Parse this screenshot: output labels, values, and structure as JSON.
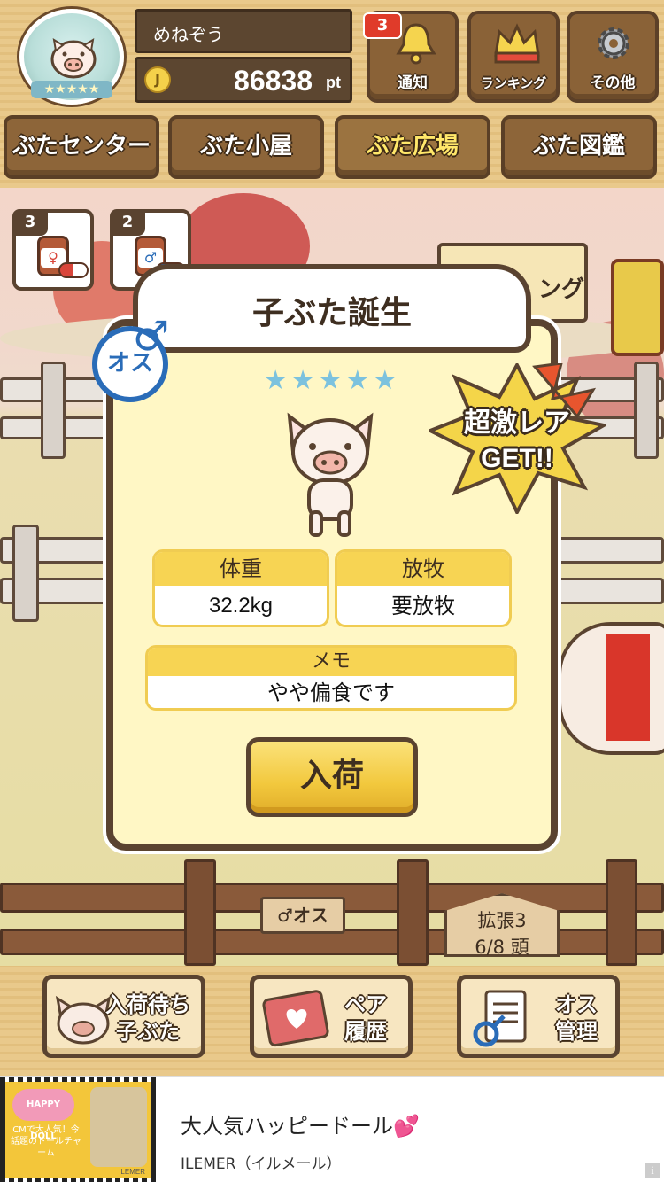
{
  "header": {
    "username": "めねぞう",
    "points": "86838",
    "points_unit": "pt",
    "coin_symbol": "J",
    "avatar_stars": "★★★★★",
    "notification_count": "3",
    "buttons": [
      {
        "label": "通知",
        "icon": "bell-icon"
      },
      {
        "label": "ランキング",
        "icon": "crown-icon"
      },
      {
        "label": "その他",
        "icon": "gear-icon"
      }
    ]
  },
  "nav": {
    "tabs": [
      {
        "label": "ぶたセンター",
        "active": false
      },
      {
        "label": "ぶた小屋",
        "active": false
      },
      {
        "label": "ぶた広場",
        "active": true
      },
      {
        "label": "ぶた図鑑",
        "active": false
      }
    ]
  },
  "potions": [
    {
      "count": "3",
      "symbol": "♀",
      "color": "#d9453a"
    },
    {
      "count": "2",
      "symbol": "♂",
      "color": "#2a6cb8"
    }
  ],
  "dialog": {
    "title": "子ぶた誕生",
    "gender_label": "オス",
    "gender_symbol": "♂",
    "rarity_stars": "★★★★★",
    "weight_label": "体重",
    "weight_value": "32.2kg",
    "grazing_label": "放牧",
    "grazing_value": "要放牧",
    "memo_label": "メモ",
    "memo_value": "やや偏食です",
    "action_label": "入荷"
  },
  "rare_badge": {
    "line1": "超激レア",
    "line2": "GET!!"
  },
  "signs": {
    "male": "♂オス",
    "expand_title": "拡張3",
    "expand_count": "6/8 頭",
    "background_fragment": "ング"
  },
  "bottom_bar": {
    "buttons": [
      {
        "line1": "入荷待ち",
        "line2": "子ぶた"
      },
      {
        "line1": "ペア",
        "line2": "履歴"
      },
      {
        "line1": "オス",
        "line2": "管理"
      }
    ]
  },
  "ad": {
    "title": "大人気ハッピードール",
    "title_icon": "💕",
    "subtitle": "ILEMER（イルメール）",
    "image_logo": "HAPPY DOLL",
    "image_text": "CMで大人気！今話題のドールチャーム",
    "image_brand": "ILEMER",
    "info_icon": "i"
  },
  "colors": {
    "wood_dark": "#5a4330",
    "dialog_bg": "#fff7c5",
    "accent_yellow": "#f7d453",
    "male_blue": "#2a6cb8",
    "female_red": "#d9453a"
  }
}
